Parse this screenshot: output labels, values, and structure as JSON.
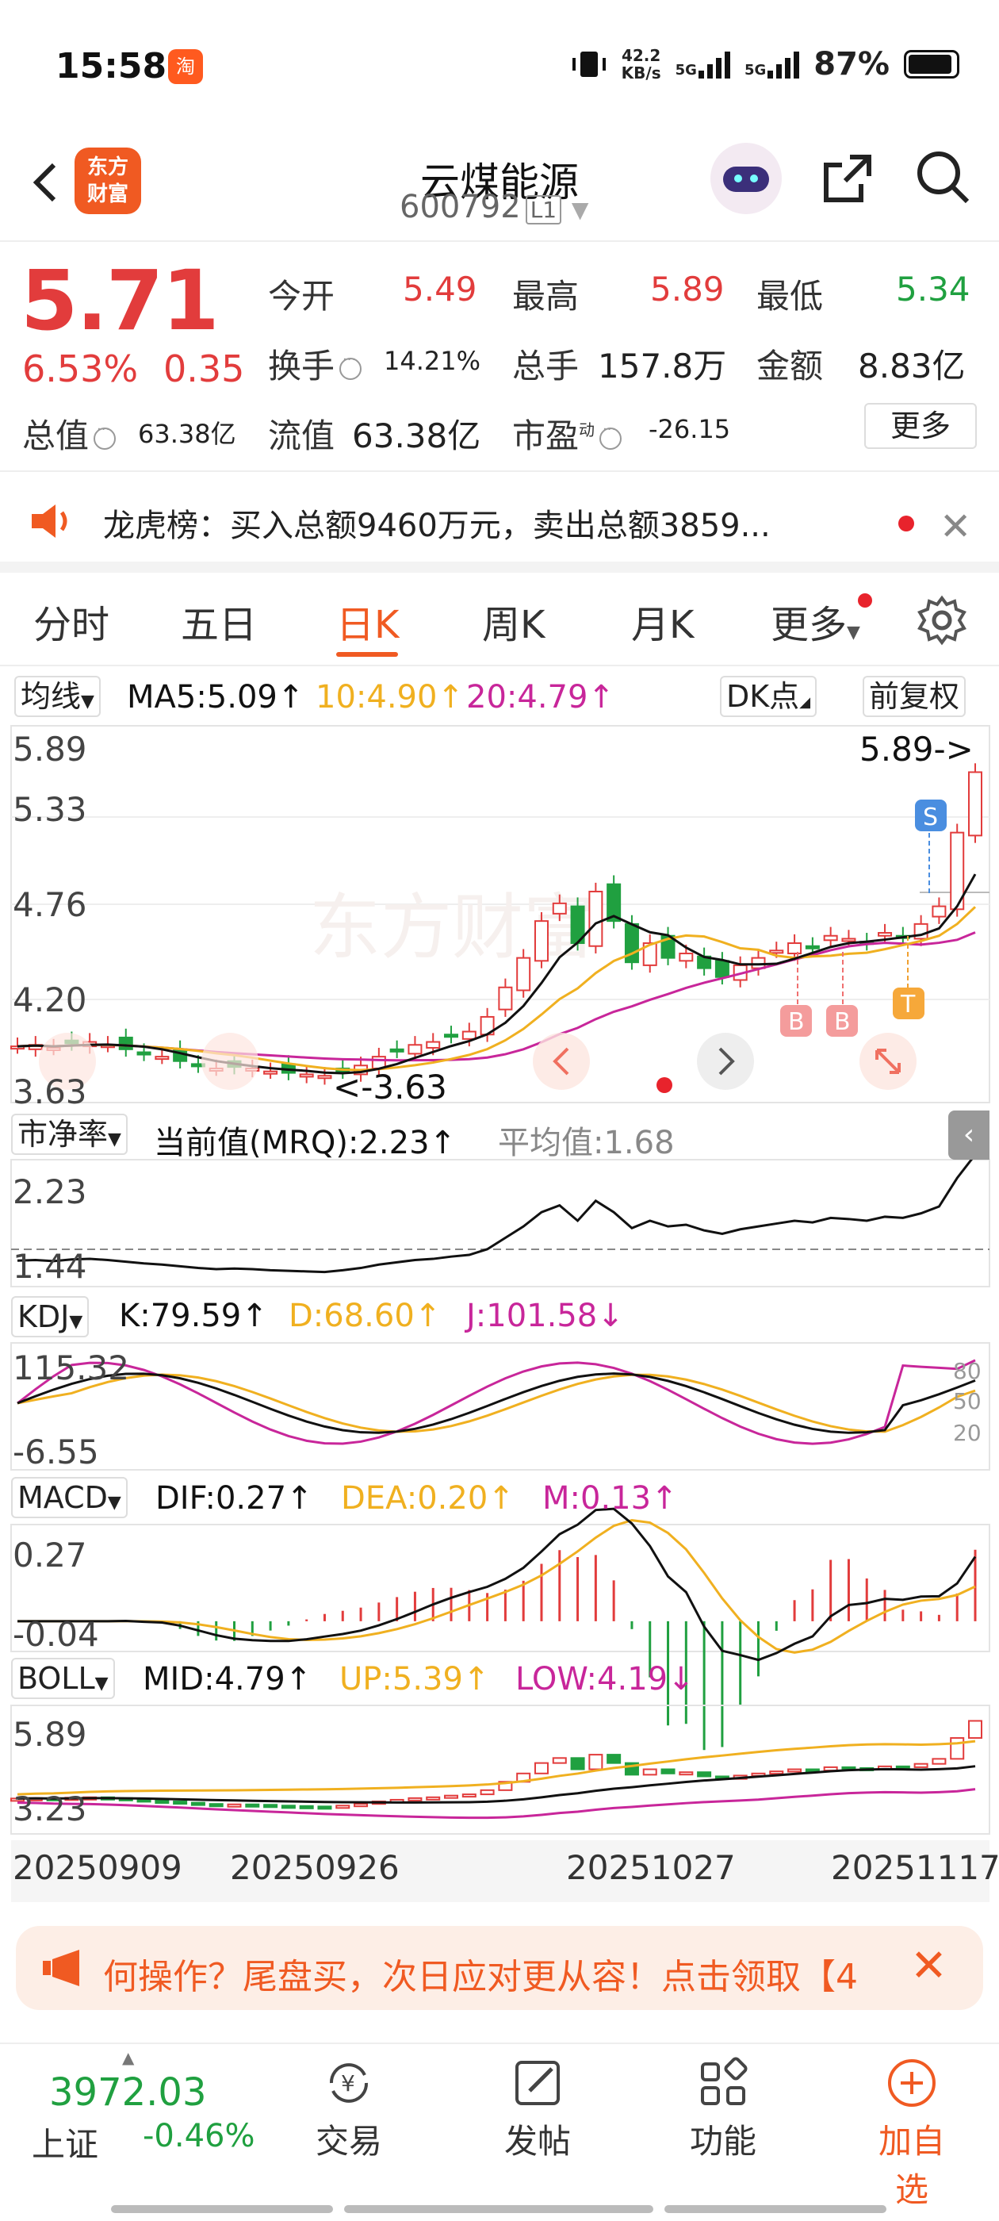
{
  "status_bar": {
    "time": "15:58",
    "app_badge": "淘",
    "net_speed_value": "42.2",
    "net_speed_unit": "KB/s",
    "sim1": "5G",
    "sim2": "5G",
    "battery": "87%"
  },
  "header": {
    "title": "云煤能源",
    "code": "600792",
    "level": "L1",
    "logo_line1": "东方",
    "logo_line2": "财富"
  },
  "quote": {
    "price": "5.71",
    "change_pct": "6.53%",
    "change": "0.35",
    "open_label": "今开",
    "open": "5.49",
    "high_label": "最高",
    "high": "5.89",
    "low_label": "最低",
    "low": "5.34",
    "turnover_label": "换手",
    "turnover": "14.21%",
    "volume_label": "总手",
    "volume": "157.8万",
    "amount_label": "金额",
    "amount": "8.83亿",
    "mktcap_label": "总值",
    "mktcap": "63.38亿",
    "float_label": "流值",
    "float": "63.38亿",
    "pe_label": "市盈",
    "pe_sup": "动",
    "pe": "-26.15",
    "more": "更多"
  },
  "notice": {
    "text": "龙虎榜：买入总额9460万元，卖出总额3859..."
  },
  "tabs": [
    "分时",
    "五日",
    "日K",
    "周K",
    "月K",
    "更多"
  ],
  "active_tab": "日K",
  "kline": {
    "ma_select": "均线",
    "ma5": "MA5:5.09",
    "ma10": "10:4.90",
    "ma20": "20:4.79",
    "arrow_up": "↑",
    "dk": "DK点",
    "adjust": "前复权",
    "y_labels": [
      "5.89",
      "5.33",
      "4.76",
      "4.20",
      "3.63"
    ],
    "high_marker": "5.89->",
    "low_marker": "<-3.63",
    "markers": {
      "s": "S",
      "b": "B",
      "t": "T"
    },
    "watermark": "东方财富"
  },
  "pb": {
    "select": "市净率",
    "current": "当前值(MRQ):2.23",
    "avg": "平均值:1.68",
    "y_top": "2.23",
    "y_bottom": "1.44"
  },
  "kdj": {
    "select": "KDJ",
    "k": "K:79.59",
    "d": "D:68.60",
    "j": "J:101.58",
    "up": "↑",
    "down": "↓",
    "y_top": "115.32",
    "y_bottom": "-6.55",
    "levels": [
      "80",
      "50",
      "20"
    ]
  },
  "macd": {
    "select": "MACD",
    "dif": "DIF:0.27",
    "dea": "DEA:0.20",
    "m": "M:0.13",
    "up": "↑",
    "y_top": "0.27",
    "y_bottom": "-0.04"
  },
  "boll": {
    "select": "BOLL",
    "mid": "MID:4.79",
    "up": "UP:5.39",
    "low": "LOW:4.19",
    "arr_up": "↑",
    "arr_down": "↓",
    "y_top": "5.89",
    "y_bottom": "3.23"
  },
  "dates": [
    "20250909",
    "20250926",
    "20251027",
    "20251117"
  ],
  "ad": {
    "text": "何操作？尾盘买，次日应对更从容！点击领取【4"
  },
  "bottom_nav": {
    "index_value": "3972.03",
    "index_name": "上证",
    "index_change": "-0.46%",
    "items": [
      "交易",
      "发帖",
      "功能",
      "加自选"
    ]
  },
  "colors": {
    "up": "#e23c3c",
    "down": "#20a040",
    "accent": "#f05a22",
    "ma10": "#f0b020",
    "ma20": "#c8269a"
  }
}
